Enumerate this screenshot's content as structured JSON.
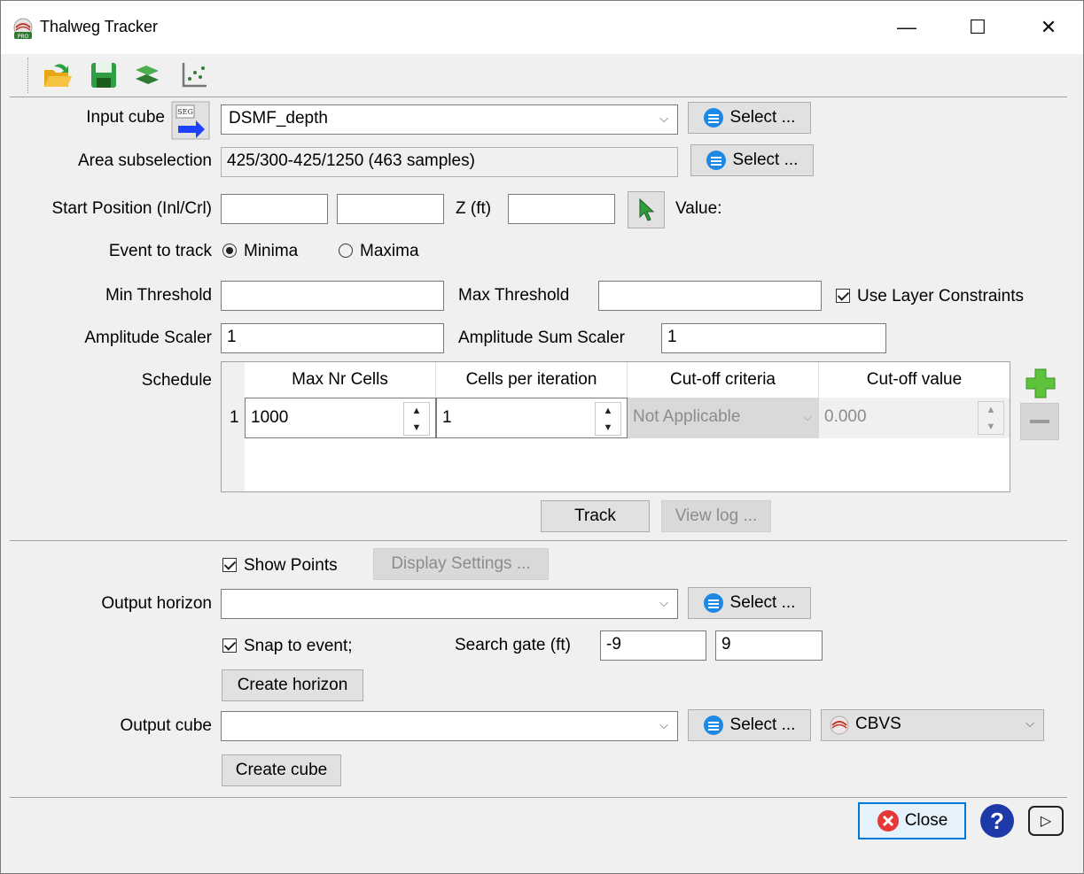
{
  "window": {
    "title": "Thalweg Tracker",
    "controls": {
      "minimize": "—",
      "maximize": "☐",
      "close": "✕"
    }
  },
  "toolbar": {
    "icons": [
      "open-folder-icon",
      "save-icon",
      "load-setup-icon",
      "chart-icon"
    ]
  },
  "input_cube": {
    "label": "Input cube",
    "value": "DSMF_depth",
    "select_label": "Select ..."
  },
  "area": {
    "label": "Area subselection",
    "value": "425/300-425/1250 (463 samples)",
    "select_label": "Select ..."
  },
  "start_position": {
    "label": "Start Position (Inl/Crl)",
    "inl": "",
    "crl": "",
    "z_label": "Z (ft)",
    "z": "",
    "value_label": "Value:"
  },
  "event": {
    "label": "Event to track",
    "options": [
      "Minima",
      "Maxima"
    ],
    "selected": "Minima"
  },
  "threshold": {
    "min_label": "Min Threshold",
    "min": "",
    "max_label": "Max Threshold",
    "max": "",
    "layer_constraints_label": "Use Layer Constraints",
    "layer_constraints_checked": true
  },
  "amplitude": {
    "scaler_label": "Amplitude Scaler",
    "scaler": "1",
    "sum_label": "Amplitude Sum Scaler",
    "sum": "1"
  },
  "schedule": {
    "label": "Schedule",
    "columns": [
      "Max Nr Cells",
      "Cells per iteration",
      "Cut-off criteria",
      "Cut-off value"
    ],
    "rows": [
      {
        "index": "1",
        "max_nr_cells": "1000",
        "cells_per_iteration": "1",
        "cutoff_criteria": "Not Applicable",
        "cutoff_value": "0.000"
      }
    ]
  },
  "track_button": "Track",
  "view_log_button": "View log ...",
  "show_points": {
    "label": "Show Points",
    "checked": true,
    "display_settings": "Display Settings ..."
  },
  "output_horizon": {
    "label": "Output horizon",
    "value": "",
    "select_label": "Select ..."
  },
  "snap": {
    "label": "Snap to event;",
    "checked": true,
    "gate_label": "Search gate (ft)",
    "gate_min": "-9",
    "gate_max": "9"
  },
  "create_horizon": "Create horizon",
  "output_cube": {
    "label": "Output cube",
    "value": "",
    "select_label": "Select ...",
    "format": "CBVS"
  },
  "create_cube": "Create cube",
  "footer": {
    "close_label": "Close",
    "help_symbol": "?",
    "play_symbol": "▷"
  }
}
